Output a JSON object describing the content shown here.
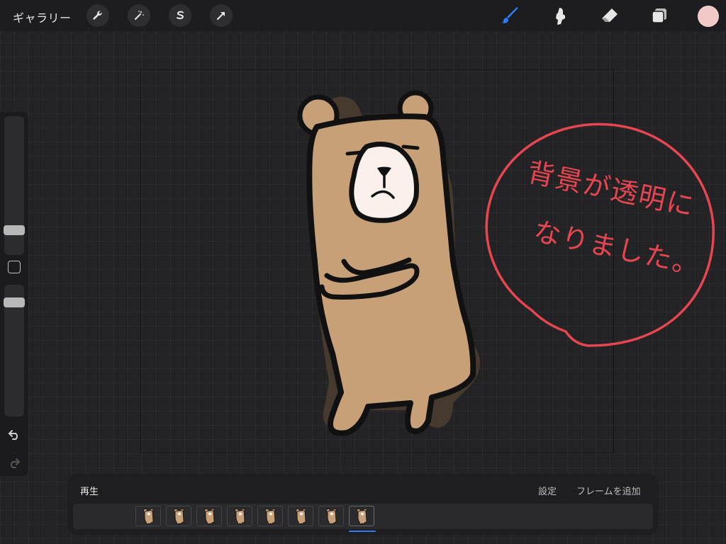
{
  "topbar": {
    "gallery_label": "ギャラリー",
    "left_tools": [
      "wrench-icon",
      "magic-wand-icon",
      "selection-icon",
      "transform-arrow-icon"
    ],
    "right_tools": [
      "brush-icon",
      "smudge-icon",
      "eraser-icon",
      "layers-icon"
    ],
    "active_tool": "brush",
    "accent_color": "#2f7cf6",
    "current_color": "#f2c9c6"
  },
  "canvas": {
    "speech_text_line1": "背景が透明に",
    "speech_text_line2": "なりました。",
    "speech_color": "#e74650",
    "bear_color": "#c8a078"
  },
  "animation_panel": {
    "play_label": "再生",
    "settings_label": "設定",
    "add_frame_label": "フレームを追加",
    "selected_frame": 8,
    "frames": [
      1,
      2,
      3,
      4,
      5,
      6,
      7,
      8
    ]
  }
}
